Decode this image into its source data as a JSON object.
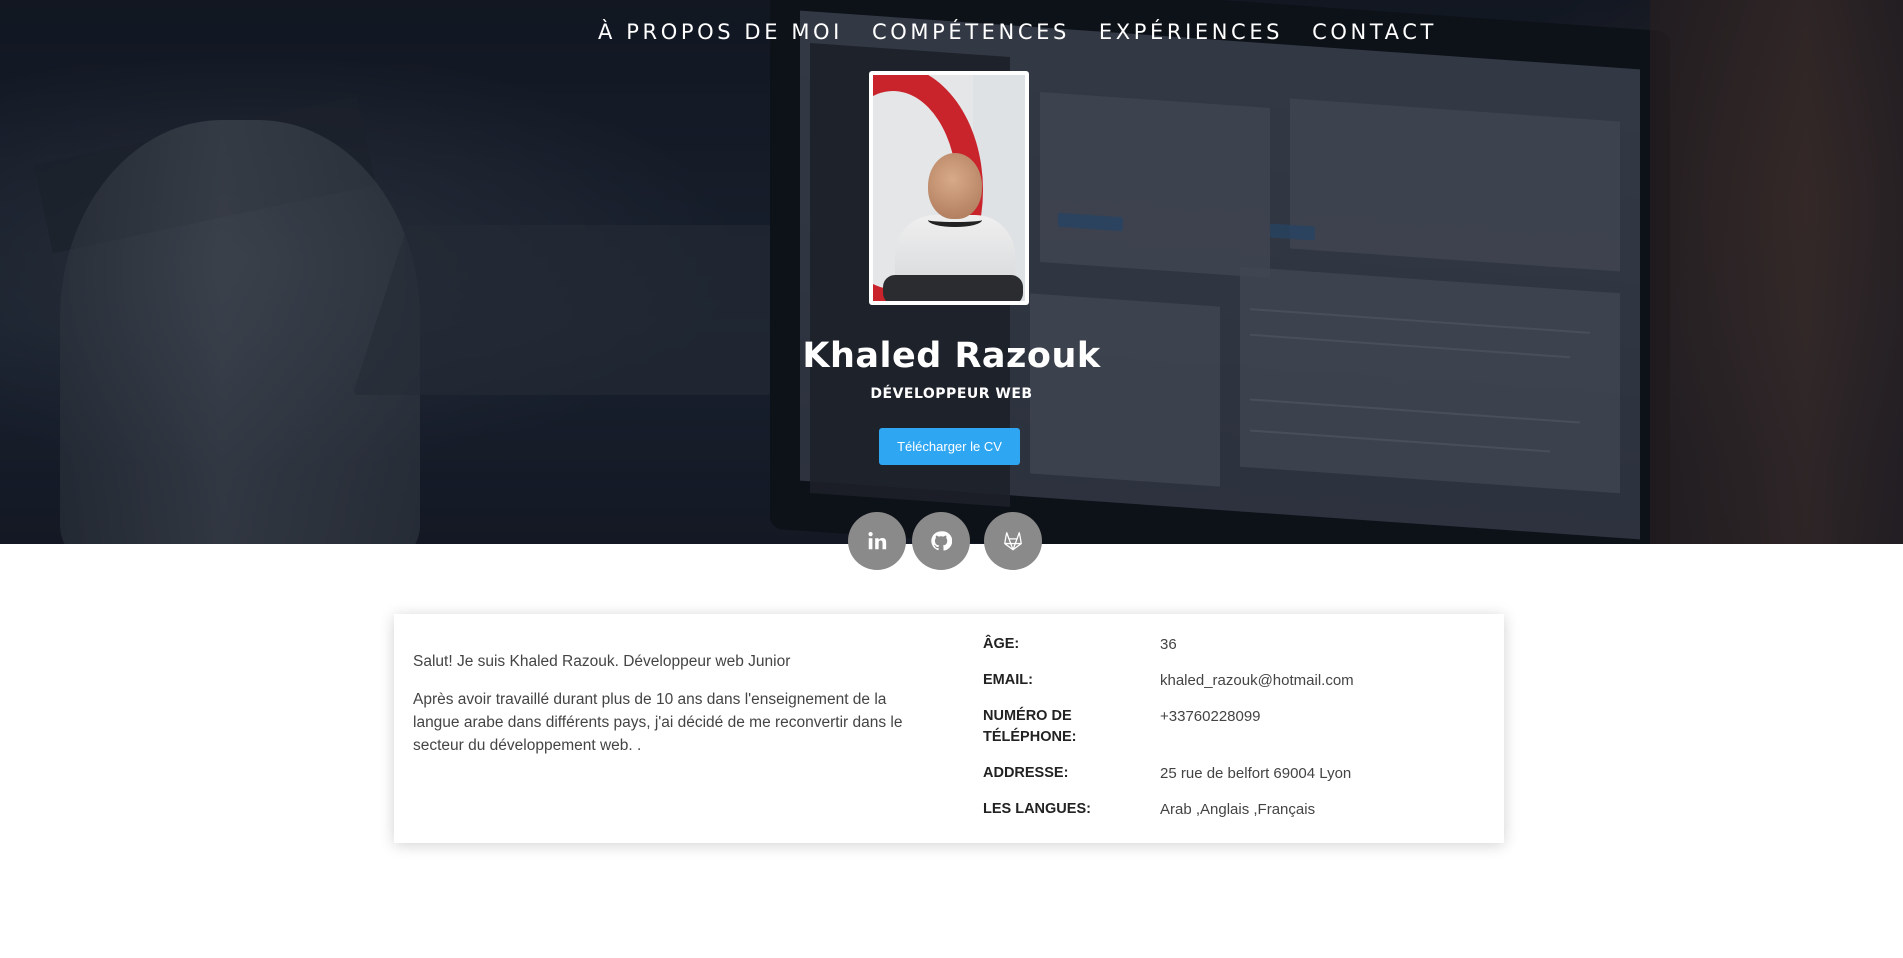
{
  "nav": {
    "items": [
      "À PROPOS DE MOI",
      "COMPÉTENCES",
      "EXPÉRIENCES",
      "CONTACT"
    ]
  },
  "hero": {
    "name": "Khaled Razouk",
    "role": "DÉVELOPPEUR WEB",
    "cv_button": "Télécharger le CV"
  },
  "social": {
    "icons": [
      "linkedin-icon",
      "github-icon",
      "gitlab-icon"
    ]
  },
  "about": {
    "greeting": "Salut! Je suis Khaled Razouk. Développeur web Junior",
    "bio": "Après avoir travaillé durant plus de 10 ans dans l'enseignement de la langue arabe dans différents pays, j'ai décidé de me reconvertir dans le secteur du développement web. .",
    "info": [
      {
        "label": "ÂGE:",
        "value": "36"
      },
      {
        "label": "EMAIL:",
        "value": "khaled_razouk@hotmail.com"
      },
      {
        "label": "NUMÉRO DE TÉLÉPHONE:",
        "value": "+33760228099"
      },
      {
        "label": "ADDRESSE:",
        "value": "25 rue de belfort 69004 Lyon"
      },
      {
        "label": "LES LANGUES:",
        "value": "Arab ,Anglais ,Français"
      }
    ]
  },
  "colors": {
    "accent": "#2fa6f2",
    "social_bg": "#8a8a8a"
  }
}
